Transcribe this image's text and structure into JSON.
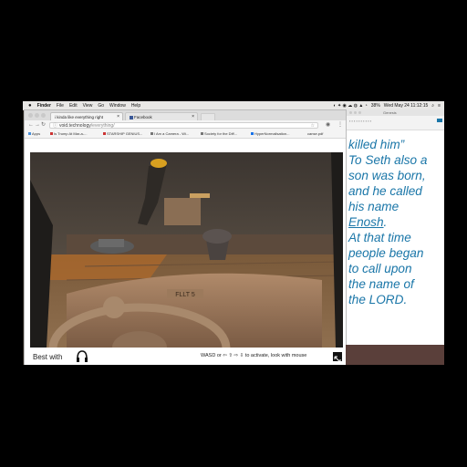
{
  "menubar": {
    "apple": "",
    "app": "Finder",
    "items": [
      "File",
      "Edit",
      "View",
      "Go",
      "Window",
      "Help"
    ],
    "battery": "38%",
    "clock": "Wed May 24  11:12:15"
  },
  "browser": {
    "tabs": [
      {
        "label": "i kinda like everything right",
        "active": true
      },
      {
        "label": "Facebook",
        "active": false
      }
    ],
    "url_host": "void.technology",
    "url_path": "/everything/",
    "bookmarks": [
      "Apps",
      "Is Trump At Mar-a-...",
      "STARSHIP GENIUS...",
      "I Am a Camera - Wi...",
      "Society for the Diff...",
      "HyperNormalisation...",
      "canse.pdf"
    ]
  },
  "page": {
    "best_with": "Best with",
    "instructions": "WASD or ⇦ ⇧ ⇨ ⇩ to activate, look with mouse",
    "dashboard_label": "FLLT 5"
  },
  "right_window": {
    "title": "Genesis",
    "lines": [
      {
        "text": "killed him”",
        "underline": false
      },
      {
        "text": "To Seth also a",
        "underline": false
      },
      {
        "text": "son was born,",
        "underline": false
      },
      {
        "text": "and he called",
        "underline": false
      },
      {
        "text": "his name",
        "underline": false
      },
      {
        "pre": "",
        "text": "Enosh",
        "post": ".",
        "underline": true
      },
      {
        "text": "At that time",
        "underline": false
      },
      {
        "text": "people began",
        "underline": false
      },
      {
        "text": "to call upon",
        "underline": false
      },
      {
        "text": "the name of",
        "underline": false
      },
      {
        "text": "the LORD.",
        "underline": false
      }
    ]
  },
  "colors": {
    "scripture": "#1a76a8",
    "menubar": "#e9e8e6"
  }
}
